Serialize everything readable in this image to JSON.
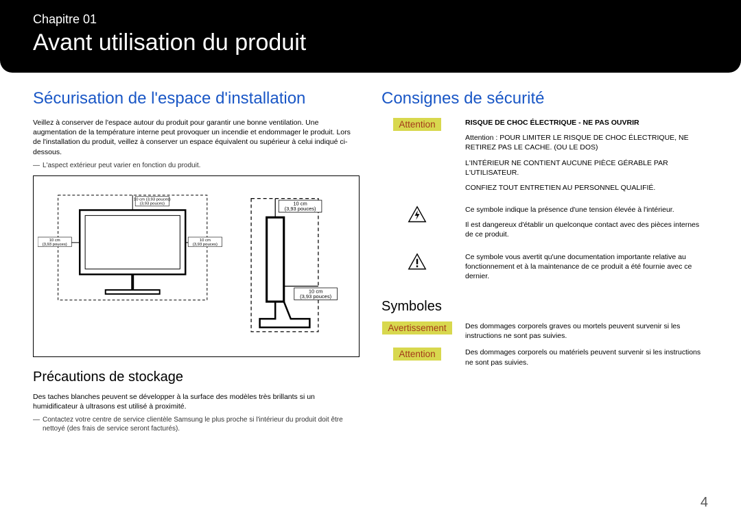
{
  "banner": {
    "chapter_label": "Chapitre 01",
    "chapter_title": "Avant utilisation du produit"
  },
  "left": {
    "section1_title": "Sécurisation de l'espace d'installation",
    "section1_para": "Veillez à conserver de l'espace autour du produit pour garantir une bonne ventilation. Une augmentation de la température interne peut provoquer un incendie et endommager le produit. Lors de l'installation du produit, veillez à conserver un espace équivalent ou supérieur à celui indiqué ci-dessous.",
    "section1_note": "L'aspect extérieur peut varier en fonction du produit.",
    "fig_labels": {
      "top": "10 cm (3,93 pouces)",
      "left": "10 cm (3,93 pouces)",
      "right": "10 cm (3,93 pouces)",
      "side_top": "10 cm (3,93 pouces)",
      "side_back": "10 cm (3,93 pouces)"
    },
    "section2_title": "Précautions de stockage",
    "section2_para": "Des taches blanches peuvent se développer à la surface des modèles très brillants si un humidificateur à ultrasons est utilisé à proximité.",
    "section2_note": "Contactez votre centre de service clientèle Samsung le plus proche si l'intérieur du produit doit être nettoyé (des frais de service seront facturés)."
  },
  "right": {
    "section1_title": "Consignes de sécurité",
    "attention_label": "Attention",
    "warn_title": "RISQUE DE CHOC ÉLECTRIQUE - NE PAS OUVRIR",
    "warn_p1": "Attention : POUR LIMITER LE RISQUE DE CHOC ÉLECTRIQUE, NE RETIREZ PAS LE CACHE. (OU LE DOS)",
    "warn_p2": "L'INTÉRIEUR NE CONTIENT AUCUNE PIÈCE GÉRABLE PAR L'UTILISATEUR.",
    "warn_p3": "CONFIEZ TOUT ENTRETIEN AU PERSONNEL QUALIFIÉ.",
    "shock_p1": "Ce symbole indique la présence d'une tension élevée à l'intérieur.",
    "shock_p2": "Il est dangereux d'établir un quelconque contact avec des pièces internes de ce produit.",
    "excl_p1": "Ce symbole vous avertit qu'une documentation importante relative au fonctionnement et à la maintenance de ce produit a été fournie avec ce dernier.",
    "symbols_title": "Symboles",
    "avert_label": "Avertissement",
    "avert_desc": "Des dommages corporels graves ou mortels peuvent survenir si les instructions ne sont pas suivies.",
    "attn2_label": "Attention",
    "attn2_desc": "Des dommages corporels ou matériels peuvent survenir si les instructions ne sont pas suivies."
  },
  "page_number": "4"
}
